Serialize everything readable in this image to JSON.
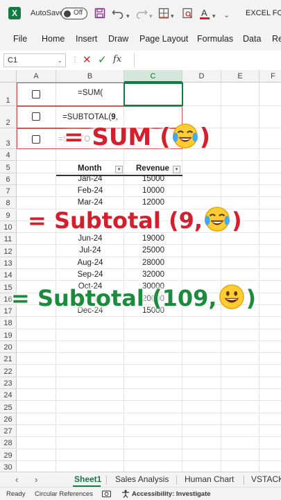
{
  "titlebar": {
    "autosave_label": "AutoSave",
    "autosave_state": "Off",
    "doc_title": "EXCEL FOR"
  },
  "menu": [
    "File",
    "Home",
    "Insert",
    "Draw",
    "Page Layout",
    "Formulas",
    "Data",
    "Re"
  ],
  "formula_bar": {
    "name_box": "C1",
    "fx_label": "fx",
    "value": ""
  },
  "columns": [
    "A",
    "B",
    "C",
    "D",
    "E",
    "F"
  ],
  "rows": [
    "1",
    "2",
    "3",
    "4",
    "5",
    "6",
    "7",
    "8",
    "9",
    "10",
    "11",
    "12",
    "13",
    "14",
    "15",
    "16",
    "17",
    "18",
    "19",
    "20",
    "21",
    "22",
    "23",
    "24",
    "25",
    "26",
    "27",
    "28",
    "29",
    "30"
  ],
  "examples": [
    {
      "formula": "=SUM("
    },
    {
      "formula_prefix": "=SUBTOTAL(",
      "formula_bold": "9",
      "formula_suffix": ","
    },
    {
      "formula": "=SUBTO"
    }
  ],
  "table": {
    "headers": [
      "Month",
      "Revenue"
    ],
    "rows": [
      {
        "month": "Jan-24",
        "revenue": "15000"
      },
      {
        "month": "Feb-24",
        "revenue": "10000"
      },
      {
        "month": "Mar-24",
        "revenue": "12000"
      },
      {
        "month": "Jun-24",
        "revenue": "19000"
      },
      {
        "month": "Jul-24",
        "revenue": "25000"
      },
      {
        "month": "Aug-24",
        "revenue": "28000"
      },
      {
        "month": "Sep-24",
        "revenue": "32000"
      },
      {
        "month": "Oct-24",
        "revenue": "30000"
      },
      {
        "month": "Nov-24",
        "revenue": "20000"
      },
      {
        "month": "Dec-24",
        "revenue": "15000"
      }
    ]
  },
  "captions": [
    {
      "text_before": "= SUM (",
      "text_after": ")",
      "emoji": "tears-of-joy-emoji",
      "color": "#d61f2c"
    },
    {
      "text_before": "= Subtotal (9,",
      "text_after": ")",
      "emoji": "tears-of-joy-emoji",
      "color": "#d61f2c"
    },
    {
      "text_before": "= Subtotal (109,",
      "text_after": ")",
      "emoji": "grinning-face-emoji",
      "color": "#1d8b3d"
    }
  ],
  "sheet_tabs": [
    "Sheet1",
    "Sales Analysis",
    "Human Chart",
    "VSTACK"
  ],
  "active_sheet": "Sheet1",
  "status": {
    "ready": "Ready",
    "circular": "Circular References",
    "accessibility": "Accessibility: Investigate"
  },
  "colors": {
    "excel_green": "#107c41",
    "caption_red": "#d61f2c",
    "caption_green": "#1d8b3d",
    "box_red": "#d95050"
  }
}
